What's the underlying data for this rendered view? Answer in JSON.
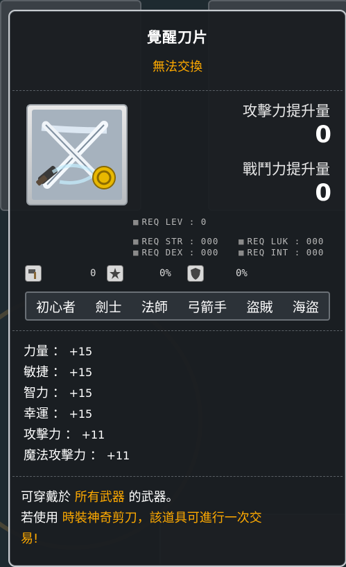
{
  "item": {
    "name": "覺醒刀片",
    "trade_status": "無法交換"
  },
  "compare": {
    "attack_label": "攻擊力提升量",
    "attack_value": "0",
    "combat_label": "戰鬥力提升量",
    "combat_value": "0"
  },
  "requirements": {
    "lev": "REQ LEV :   0",
    "str": "REQ STR : 000",
    "dex": "REQ DEX : 000",
    "luk": "REQ LUK : 000",
    "int": "REQ INT : 000"
  },
  "mini_stats": {
    "upgrade_value": "0",
    "star_value": "0%",
    "shield_value": "0%"
  },
  "jobs": [
    "初心者",
    "劍士",
    "法師",
    "弓箭手",
    "盜賊",
    "海盜"
  ],
  "stats": [
    {
      "label": "力量 ：",
      "value": "+15"
    },
    {
      "label": "敏捷 ：",
      "value": "+15"
    },
    {
      "label": "智力 ：",
      "value": "+15"
    },
    {
      "label": "幸運 ：",
      "value": "+15"
    },
    {
      "label": "攻擊力 ：",
      "value": "+11"
    },
    {
      "label": "魔法攻擊力 ：",
      "value": "+11"
    }
  ],
  "description": {
    "line1_a": "可穿戴於 ",
    "line1_hl": "所有武器",
    "line1_b": " 的武器。",
    "line2_a": "若使用 ",
    "line2_hl": "時裝神奇剪刀，該道具可進行一次交",
    "line3_hl": "易!"
  },
  "colors": {
    "accent": "#ffaa00",
    "text": "#ffffff",
    "border": "#c8ccd0"
  }
}
